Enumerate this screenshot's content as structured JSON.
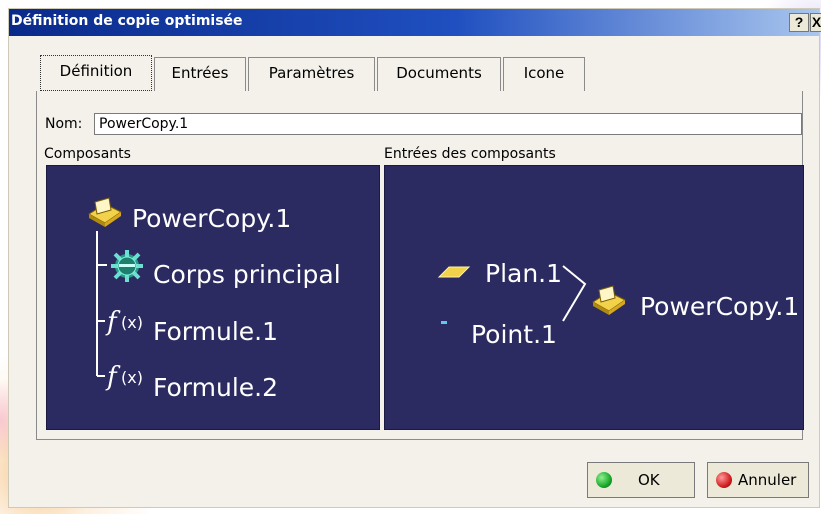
{
  "window": {
    "title": "Définition de copie optimisée",
    "help_label": "?",
    "close_label": "X"
  },
  "tabs": [
    {
      "label": "Définition",
      "active": true
    },
    {
      "label": "Entrées",
      "active": false
    },
    {
      "label": "Paramètres",
      "active": false
    },
    {
      "label": "Documents",
      "active": false
    },
    {
      "label": "Icone",
      "active": false
    }
  ],
  "name_field": {
    "label": "Nom:",
    "value": "PowerCopy.1"
  },
  "components": {
    "label": "Composants",
    "root": {
      "label": "PowerCopy.1",
      "icon": "powercopy-icon"
    },
    "children": [
      {
        "label": "Corps principal",
        "icon": "gear-icon"
      },
      {
        "label": "Formule.1",
        "icon": "formula-icon"
      },
      {
        "label": "Formule.2",
        "icon": "formula-icon"
      }
    ]
  },
  "inputs": {
    "label": "Entrées des composants",
    "items": [
      {
        "label": "Plan.1",
        "icon": "plane-icon"
      },
      {
        "label": "Point.1",
        "icon": "point-icon"
      }
    ],
    "target": {
      "label": "PowerCopy.1",
      "icon": "powercopy-icon"
    }
  },
  "buttons": {
    "ok_label": "OK",
    "cancel_label": "Annuler"
  },
  "colors": {
    "panel_bg": "#2b2b61",
    "title_gradient_start": "#0a2a8a",
    "ok_dot": "#1aa82a",
    "cancel_dot": "#d12020"
  }
}
